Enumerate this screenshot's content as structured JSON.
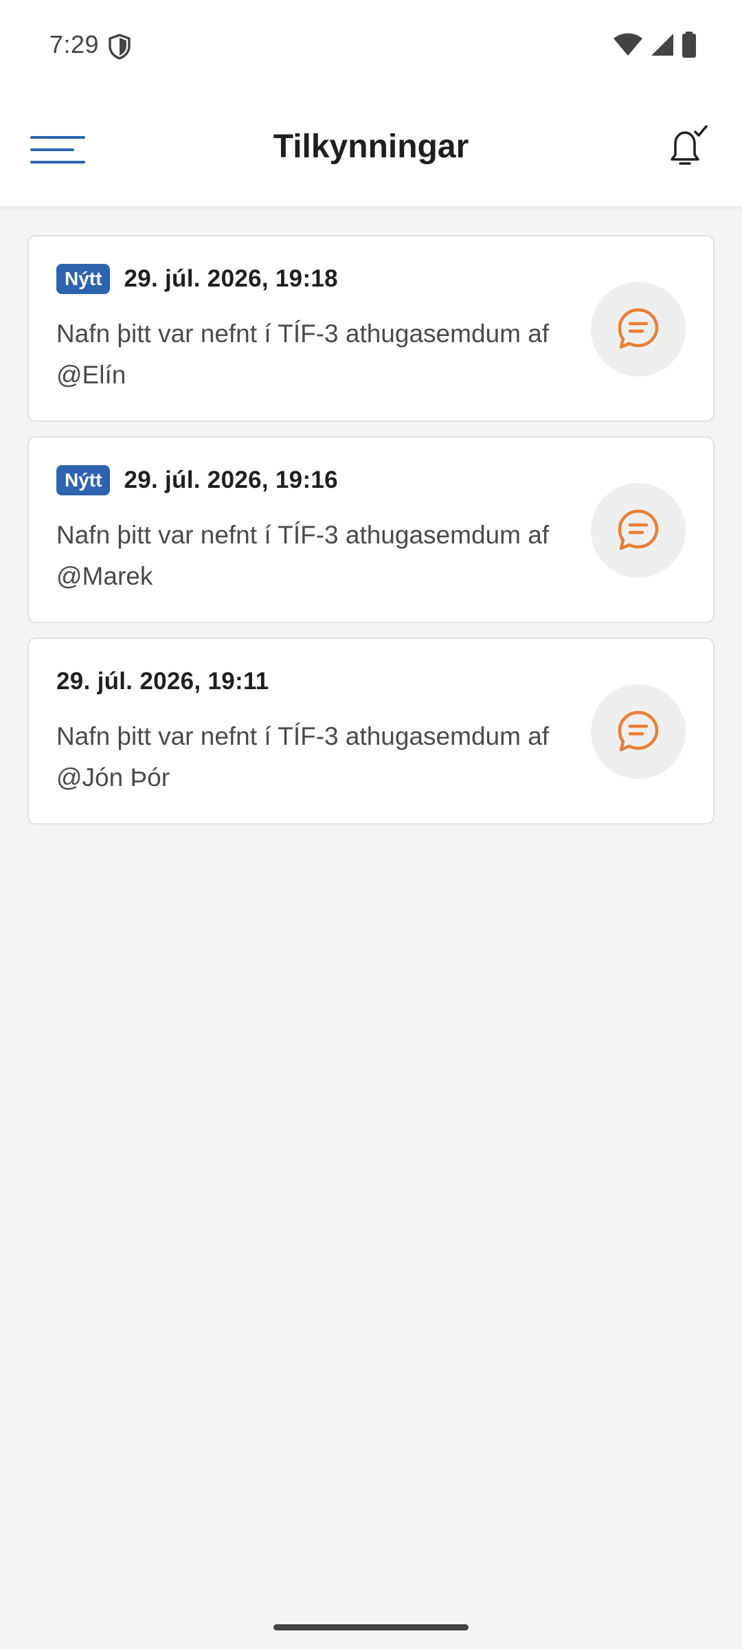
{
  "status_bar": {
    "time": "7:29",
    "icons": [
      "shield-icon",
      "wifi-icon",
      "cellular-icon",
      "battery-icon"
    ]
  },
  "app_bar": {
    "title": "Tilkynningar",
    "menu_icon": "menu-icon",
    "bell_icon": "bell-check-icon"
  },
  "colors": {
    "accent": "#2E64AD",
    "icon_orange": "#E97F35",
    "background": "#F5F5F7"
  },
  "notifications": [
    {
      "badge": "Nýtt",
      "date": "29. júl. 2026, 19:18",
      "text": "Nafn þitt var nefnt í TÍF-3 athugasemdum af  @Elín",
      "icon": "comment-icon"
    },
    {
      "badge": "Nýtt",
      "date": "29. júl. 2026, 19:16",
      "text": "Nafn þitt var nefnt í TÍF-3 athugasemdum af  @Marek",
      "icon": "comment-icon"
    },
    {
      "badge": "",
      "date": "29. júl. 2026, 19:11",
      "text": "Nafn þitt var nefnt í TÍF-3 athugasemdum af  @Jón Þór",
      "icon": "comment-icon"
    }
  ]
}
